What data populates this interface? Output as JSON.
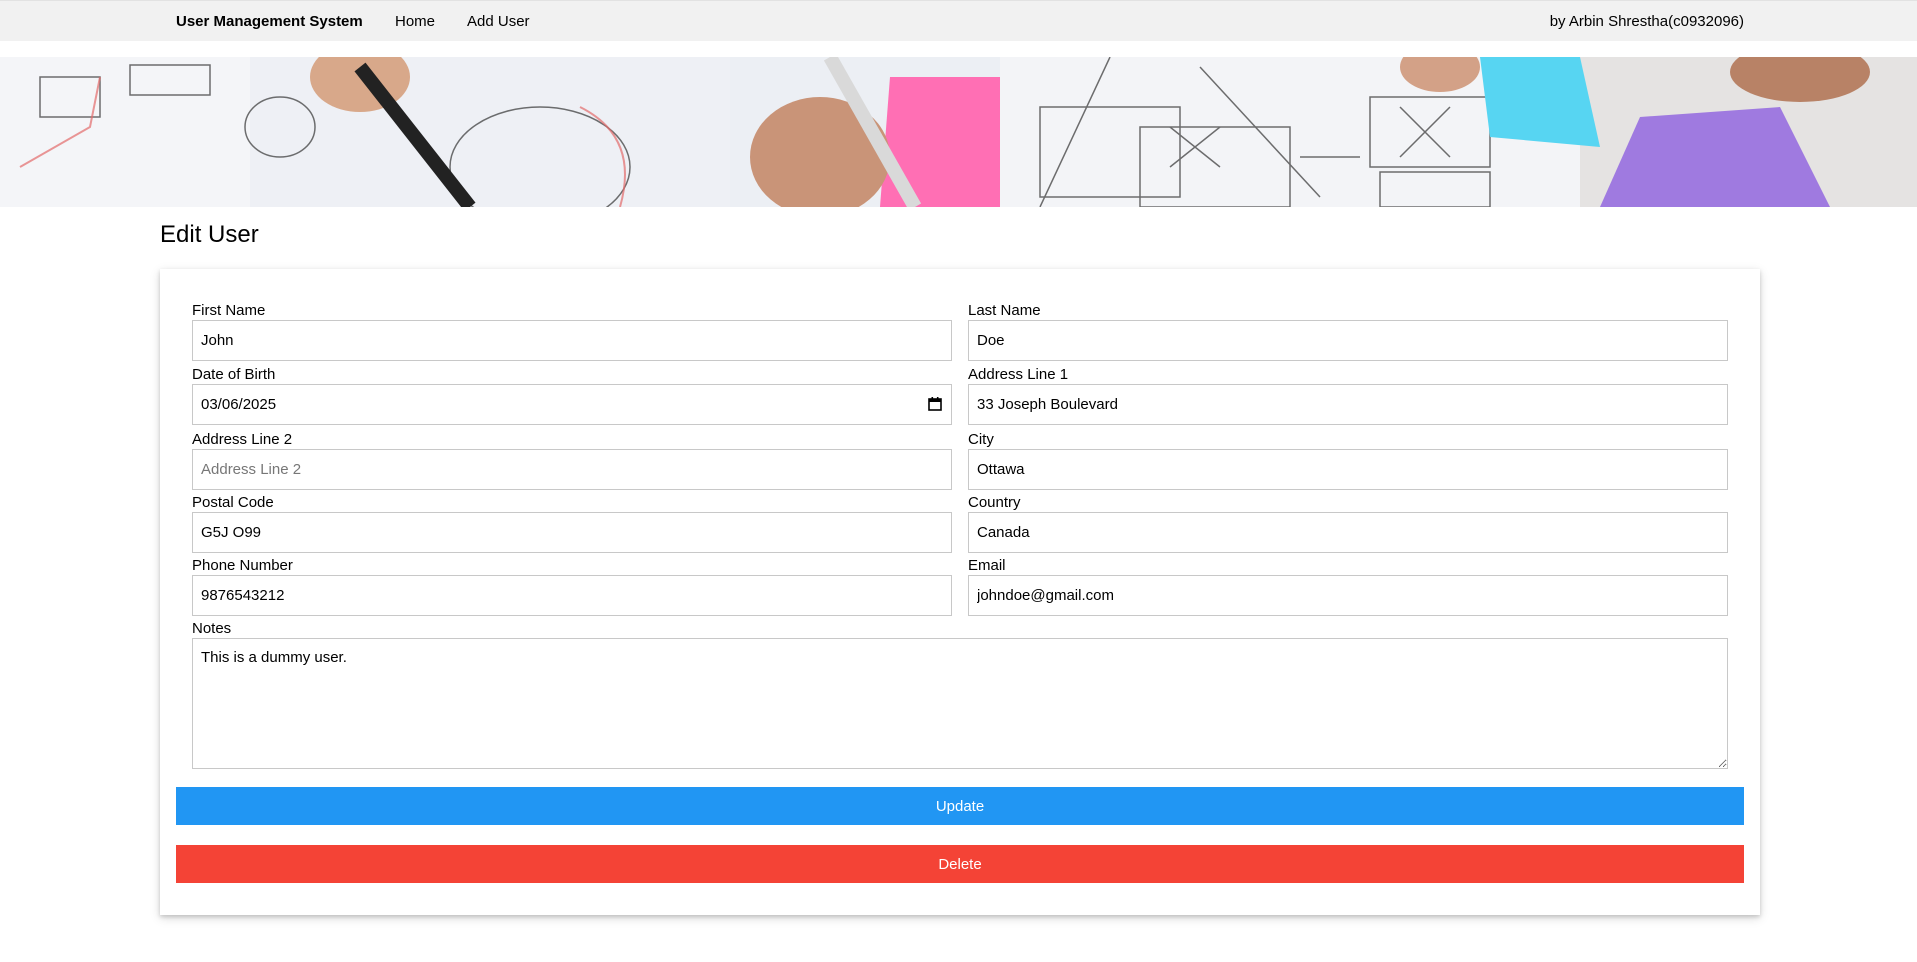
{
  "nav": {
    "brand": "User Management System",
    "items": [
      {
        "label": "Home"
      },
      {
        "label": "Add User"
      }
    ],
    "author": "by Arbin Shrestha(c0932096)"
  },
  "page": {
    "title": "Edit User"
  },
  "form": {
    "first_name": {
      "label": "First Name",
      "value": "John"
    },
    "last_name": {
      "label": "Last Name",
      "value": "Doe"
    },
    "dob": {
      "label": "Date of Birth",
      "value": "2025-03-06",
      "display": "03/06/2025"
    },
    "address1": {
      "label": "Address Line 1",
      "value": "33 Joseph Boulevard"
    },
    "address2": {
      "label": "Address Line 2",
      "value": "",
      "placeholder": "Address Line 2"
    },
    "city": {
      "label": "City",
      "value": "Ottawa"
    },
    "postal": {
      "label": "Postal Code",
      "value": "G5J O99"
    },
    "country": {
      "label": "Country",
      "value": "Canada"
    },
    "phone": {
      "label": "Phone Number",
      "value": "9876543212"
    },
    "email": {
      "label": "Email",
      "value": "johndoe@gmail.com"
    },
    "notes": {
      "label": "Notes",
      "value": "This is a dummy user."
    }
  },
  "buttons": {
    "update": {
      "label": "Update",
      "color": "#2196f3"
    },
    "delete": {
      "label": "Delete",
      "color": "#f44336"
    }
  },
  "colors": {
    "navbar_bg": "#f1f1f1",
    "input_border": "#c8c8c8"
  },
  "icons": {
    "date_picker": "calendar-icon"
  }
}
